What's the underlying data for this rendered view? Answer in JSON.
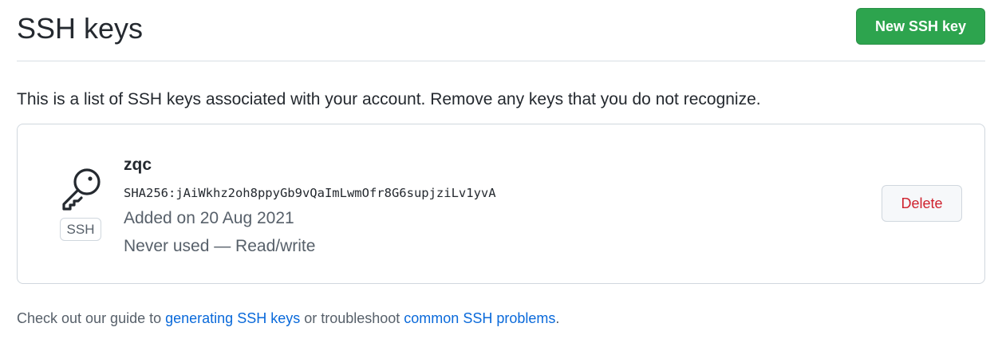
{
  "header": {
    "title": "SSH keys",
    "new_key_button": "New SSH key"
  },
  "intro": "This is a list of SSH keys associated with your account. Remove any keys that you do not recognize.",
  "keys": [
    {
      "icon": "key-icon",
      "type_label": "SSH",
      "title": "zqc",
      "fingerprint": "SHA256:jAiWkhz2oh8ppyGb9vQaImLwmOfr8G6supjziLv1yvA",
      "added": "Added on 20 Aug 2021",
      "usage": "Never used — Read/write",
      "delete_label": "Delete"
    }
  ],
  "footer": {
    "prefix": "Check out our guide to ",
    "link1": "generating SSH keys",
    "middle": " or troubleshoot ",
    "link2": "common SSH problems",
    "suffix": "."
  },
  "colors": {
    "primary_button": "#2da44e",
    "danger_text": "#cf222e",
    "link": "#0969da",
    "muted_text": "#57606a",
    "border": "#d0d7de"
  }
}
